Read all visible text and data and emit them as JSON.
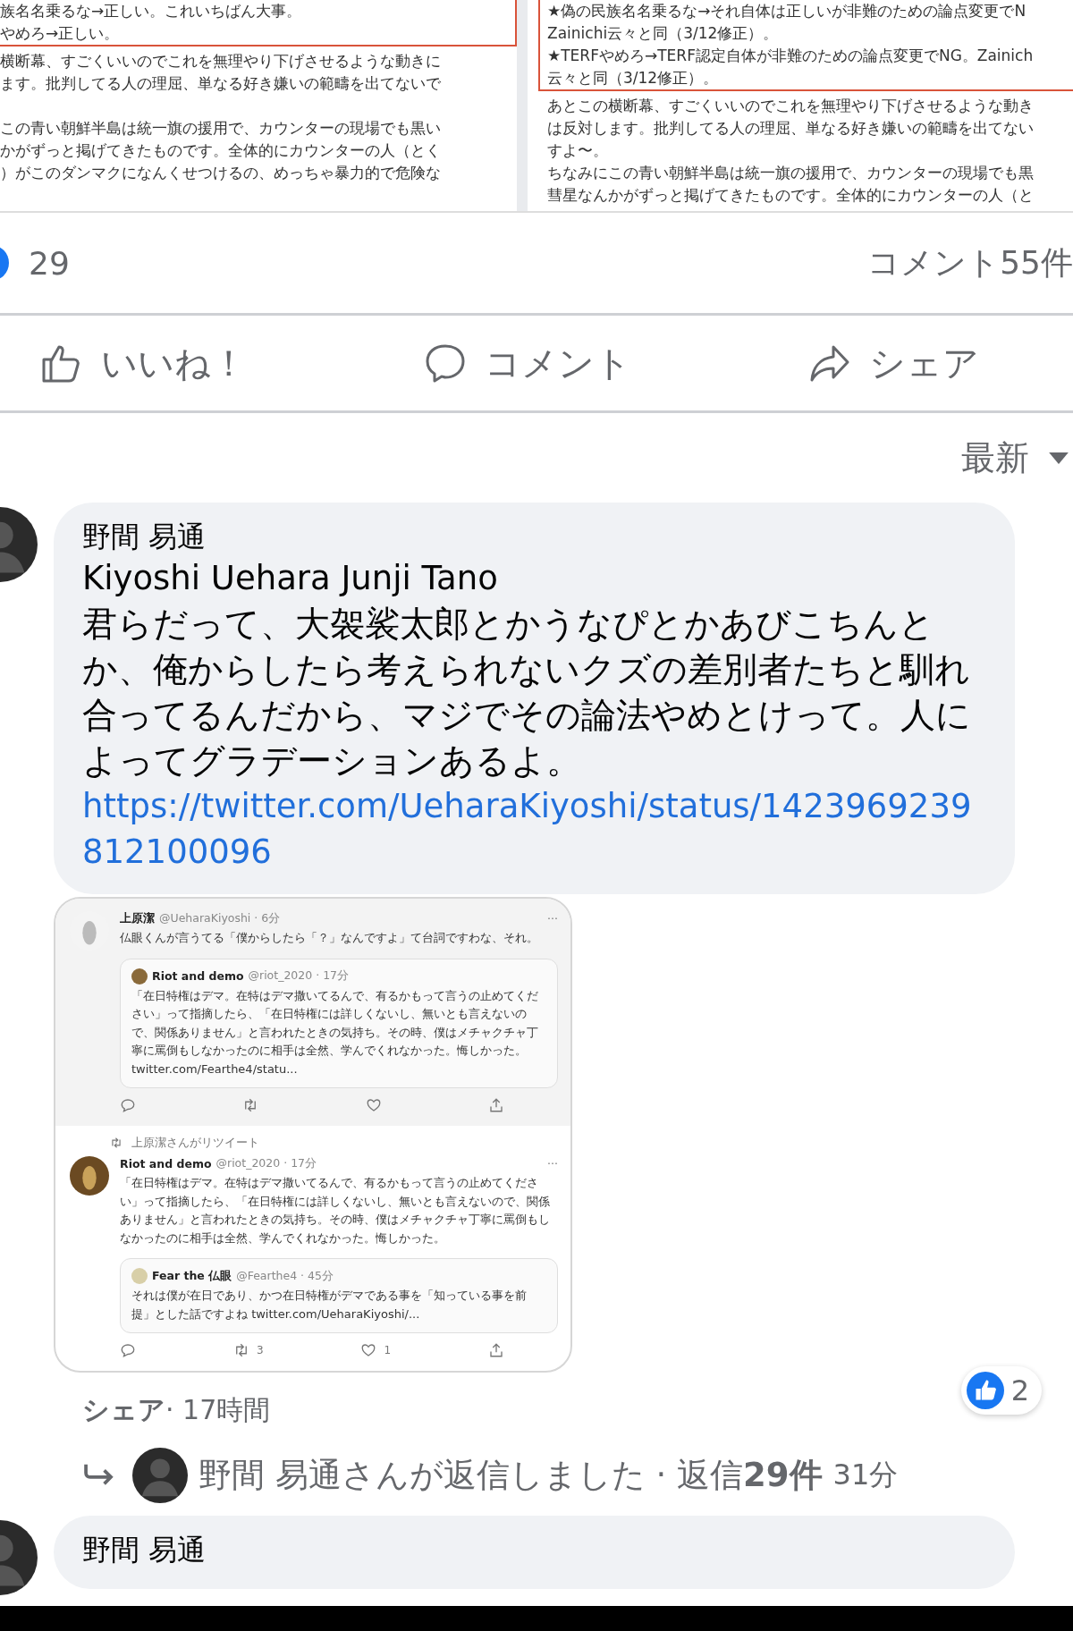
{
  "document_image": {
    "left_column": {
      "boxed_lines": [
        "族名名乗るな→正しい。これいちばん大事。",
        "やめろ→正しい。"
      ],
      "paragraphs": [
        [
          "横断幕、すごくいいのでこれを無理やり下げさせるような動きに",
          "ます。批判してる人の理屈、単なる好き嫌いの範疇を出てないで"
        ],
        [
          "この青い朝鮮半島は統一旗の援用で、カウンターの現場でも黒い",
          "かがずっと掲げてきたものです。全体的にカウンターの人（とく",
          "）がこのダンマクになんくせつけるの、めっちゃ暴力的で危険な"
        ]
      ]
    },
    "right_column": {
      "boxed_lines": [
        "★偽の民族名名乗るな→それ自体は正しいが非難のための論点変更でN",
        "Zainichi云々と同（3/12修正）。",
        "★TERFやめろ→TERF認定自体が非難のための論点変更でNG。Zainich",
        "云々と同（3/12修正）。"
      ],
      "paragraphs": [
        [
          "あとこの横断幕、すごくいいのでこれを無理やり下げさせるような動き",
          "は反対します。批判してる人の理屈、単なる好き嫌いの範疇を出てない",
          "すよ〜。",
          "ちなみにこの青い朝鮮半島は統一旗の援用で、カウンターの現場でも黒",
          "彗星なんかがずっと掲げてきたものです。全体的にカウンターの人（と"
        ]
      ]
    }
  },
  "reactions": {
    "count": "29",
    "comments": "コメント55件"
  },
  "actions": [
    {
      "kind": "like",
      "label": "いいね！"
    },
    {
      "kind": "comment",
      "label": "コメント"
    },
    {
      "kind": "share",
      "label": "シェア"
    }
  ],
  "sort": {
    "label": "最新"
  },
  "comments": [
    {
      "author": "野間 易通",
      "mention": "Kiyoshi Uehara Junji Tano",
      "text": "君らだって、大袈裟太郎とかうなぴとかあびこちんとか、俺からしたら考えられないクズの差別者たちと馴れ合ってるんだから、マジでその論法やめとけって。人によってグラデーションあるよ。",
      "link": "https://twitter.com/UeharaKiyoshi/status/1423969239812100096",
      "attachment": {
        "kind": "tweet_screenshot",
        "tweets": [
          {
            "shaded": true,
            "name": "上原潔",
            "handle": "@UeharaKiyoshi · 6分",
            "more": "···",
            "text": "仏眼くんが言うてる「僕からしたら「？」なんですよ」て台詞ですわな、それ。",
            "quote": {
              "name": "Riot and demo",
              "handle": "@riot_2020 · 17分",
              "text": "「在日特権はデマ。在特はデマ撒いてるんで、有るかもって言うの止めてください」って指摘したら、「在日特権には詳しくないし、無いとも言えないので、関係ありません」と言われたときの気持ち。その時、僕はメチャクチャ丁寧に罵倒もしなかったのに相手は全然、学んでくれなかった。悔しかった。 twitter.com/Fearthe4/statu..."
            },
            "actions": [
              {
                "kind": "reply"
              },
              {
                "kind": "retweet"
              },
              {
                "kind": "like"
              },
              {
                "kind": "share"
              }
            ]
          },
          {
            "shaded": false,
            "retweeted_by": "上原潔さんがリツイート",
            "name": "Riot and demo",
            "handle": "@riot_2020 · 17分",
            "more": "···",
            "text": "「在日特権はデマ。在特はデマ撒いてるんで、有るかもって言うの止めてください」って指摘したら、「在日特権には詳しくないし、無いとも言えないので、関係ありません」と言われたときの気持ち。その時、僕はメチャクチャ丁寧に罵倒もしなかったのに相手は全然、学んでくれなかった。悔しかった。",
            "quote": {
              "name": "Fear the 仏眼",
              "handle": "@Fearthe4 · 45分",
              "text": "それは僕が在日であり、かつ在日特権がデマである事を「知っている事を前提」とした話ですよね twitter.com/UeharaKiyoshi/..."
            },
            "actions": [
              {
                "kind": "reply"
              },
              {
                "kind": "retweet",
                "count": "3"
              },
              {
                "kind": "like",
                "count": "1"
              },
              {
                "kind": "share"
              }
            ]
          }
        ]
      },
      "meta": {
        "action": "シェア",
        "time": "· 17時間"
      },
      "reaction_count": "2",
      "replies": {
        "text": "野間 易通さんが返信しました · 返信**29件**",
        "time": "31分"
      }
    },
    {
      "author": "野間 易通"
    }
  ]
}
